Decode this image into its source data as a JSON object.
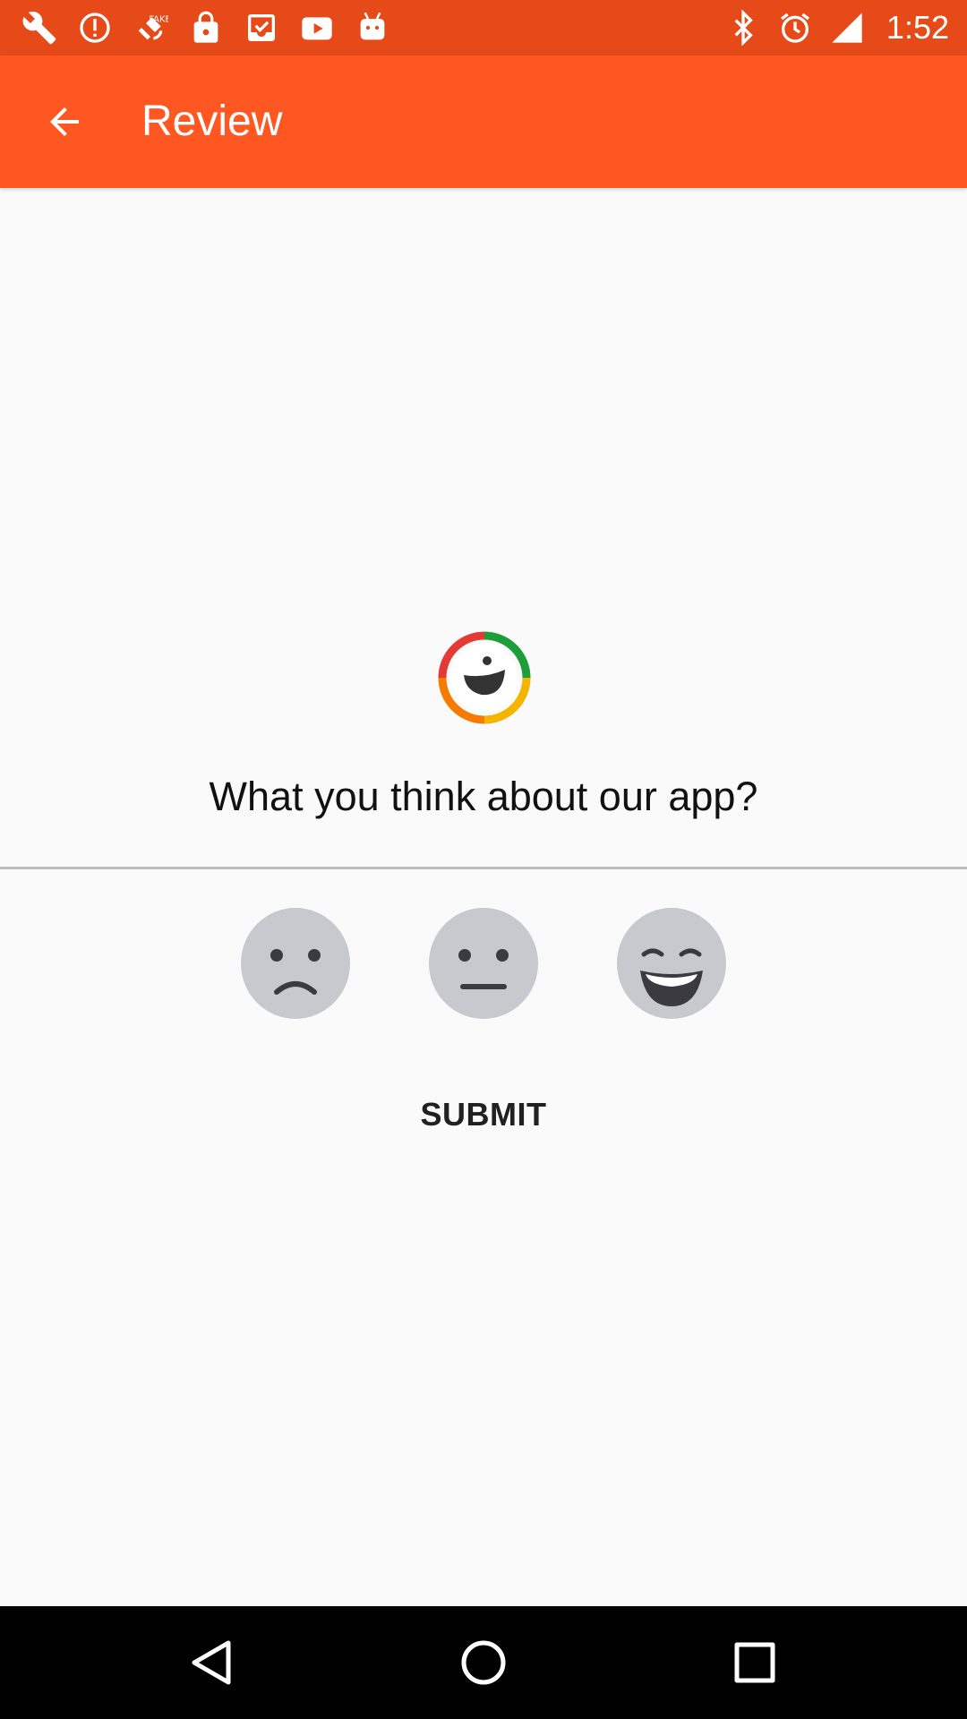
{
  "status_bar": {
    "time": "1:52",
    "left_icons": [
      "wrench-icon",
      "alert-icon",
      "fake-gps-icon",
      "lock-icon",
      "inbox-check-icon",
      "youtube-icon",
      "android-icon"
    ],
    "right_icons": [
      "bluetooth-icon",
      "alarm-icon",
      "signal-icon"
    ],
    "color": "#e64a19"
  },
  "app_bar": {
    "title": "Review",
    "color": "#ff5722"
  },
  "review": {
    "question": "What you think about our app?",
    "faces": [
      "sad",
      "neutral",
      "happy"
    ],
    "face_color": "#c8c9ce",
    "submit_label": "SUBMIT"
  },
  "nav_bar": {
    "buttons": [
      "back",
      "home",
      "recents"
    ]
  }
}
